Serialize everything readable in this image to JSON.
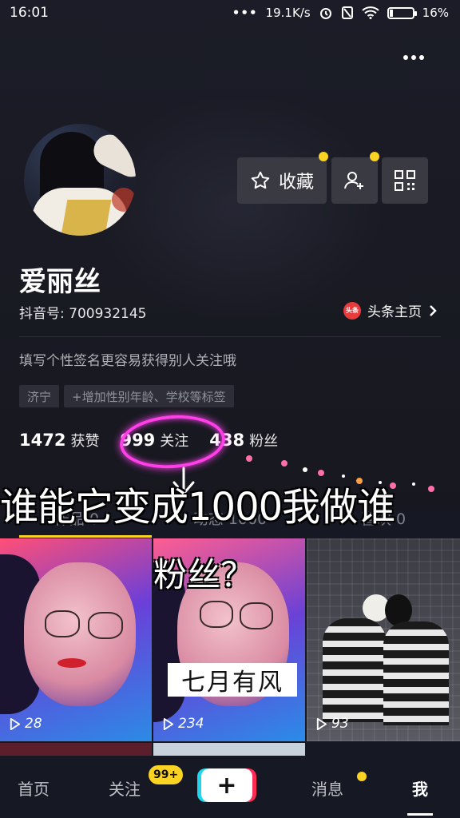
{
  "status_bar": {
    "time": "16:01",
    "signal_dots": "•••",
    "speed": "19.1K/s",
    "battery_text": "16%",
    "battery_level": 0.16
  },
  "profile": {
    "nickname": "爱丽丝",
    "douyin_id": "抖音号: 700932145",
    "toutiao_label": "头条主页",
    "toutiao_icon_text": "头条",
    "signature": "填写个性签名更容易获得别人关注哦",
    "tags": [
      "济宁",
      "+增加性别年龄、学校等标签"
    ],
    "favorite_label": "收藏"
  },
  "stats": {
    "likes_count": "1472",
    "likes_label": "获赞",
    "following_count": "999",
    "following_label": "关注",
    "followers_count": "438",
    "followers_label": "粉丝"
  },
  "tabs": [
    "作品 0",
    "动态 1000",
    "喜欢 0"
  ],
  "overlay": {
    "line1": "谁能它变成1000我做谁",
    "line2": "粉丝？"
  },
  "videos": [
    {
      "plays": "28"
    },
    {
      "plays": "234",
      "caption": "七月有风"
    },
    {
      "plays": "93"
    }
  ],
  "bottom_nav": {
    "home": "首页",
    "following": "关注",
    "following_badge": "99+",
    "plus": "+",
    "messages": "消息",
    "me": "我"
  },
  "colors": {
    "background": "#161823",
    "accent_yellow": "#fbd322",
    "annotation_pink": "#ff3fe8",
    "tiktok_cyan": "#20d5ec",
    "tiktok_red": "#fe2c55"
  }
}
